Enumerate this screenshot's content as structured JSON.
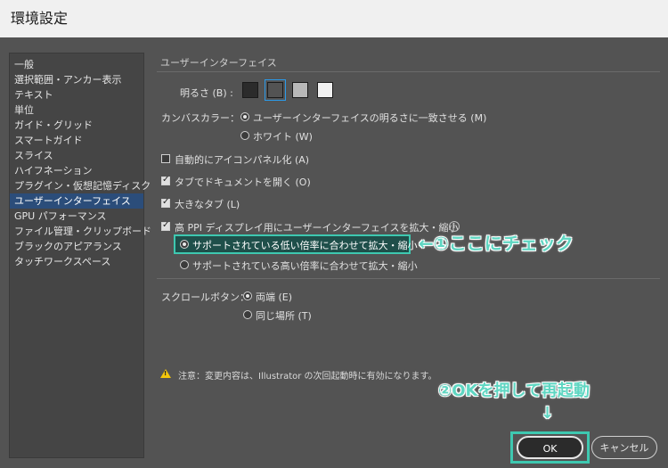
{
  "window": {
    "title": "環境設定"
  },
  "sidebar": {
    "items": [
      {
        "label": "一般",
        "selected": false
      },
      {
        "label": "選択範囲・アンカー表示",
        "selected": false
      },
      {
        "label": "テキスト",
        "selected": false
      },
      {
        "label": "単位",
        "selected": false
      },
      {
        "label": "ガイド・グリッド",
        "selected": false
      },
      {
        "label": "スマートガイド",
        "selected": false
      },
      {
        "label": "スライス",
        "selected": false
      },
      {
        "label": "ハイフネーション",
        "selected": false
      },
      {
        "label": "プラグイン・仮想記憶ディスク",
        "selected": false
      },
      {
        "label": "ユーザーインターフェイス",
        "selected": true
      },
      {
        "label": "GPU パフォーマンス",
        "selected": false
      },
      {
        "label": "ファイル管理・クリップボード",
        "selected": false
      },
      {
        "label": "ブラックのアピアランス",
        "selected": false
      },
      {
        "label": "タッチワークスペース",
        "selected": false
      }
    ]
  },
  "main": {
    "section_title": "ユーザーインターフェイス",
    "brightness": {
      "label": "明るさ (B) :",
      "swatch_colors": [
        "#2b2b2b",
        "#535353",
        "#b8b8b8",
        "#f0f0f0"
      ],
      "selected_index": 1
    },
    "canvas_color": {
      "label": "カンバスカラー：",
      "options": [
        {
          "label": "ユーザーインターフェイスの明るさに一致させる (M)",
          "selected": true
        },
        {
          "label": "ホワイト (W)",
          "selected": false
        }
      ]
    },
    "checkboxes": [
      {
        "label": "自動的にアイコンパネル化 (A)",
        "checked": false
      },
      {
        "label": "タブでドキュメントを開く (O)",
        "checked": true
      },
      {
        "label": "大きなタブ (L)",
        "checked": true
      },
      {
        "label": "高 PPI ディスプレイ用にユーザーインターフェイスを拡大・縮小",
        "checked": true
      }
    ],
    "scaling_options": [
      {
        "label": "サポートされている低い倍率に合わせて拡大・縮小",
        "selected": true
      },
      {
        "label": "サポートされている高い倍率に合わせて拡大・縮小",
        "selected": false
      }
    ],
    "scroll_buttons": {
      "label": "スクロールボタン：",
      "options": [
        {
          "label": "両端 (E)",
          "selected": true
        },
        {
          "label": "同じ場所 (T)",
          "selected": false
        }
      ]
    },
    "note": "注意：変更内容は、Illustrator の次回起動時に有効になります。"
  },
  "buttons": {
    "ok": "OK",
    "cancel": "キャンセル"
  },
  "annotations": {
    "check_here": "←①ここにチェック",
    "press_ok": "②OKを押して再起動",
    "arrow_down": "↓",
    "accent_color": "#3ec8b0"
  }
}
